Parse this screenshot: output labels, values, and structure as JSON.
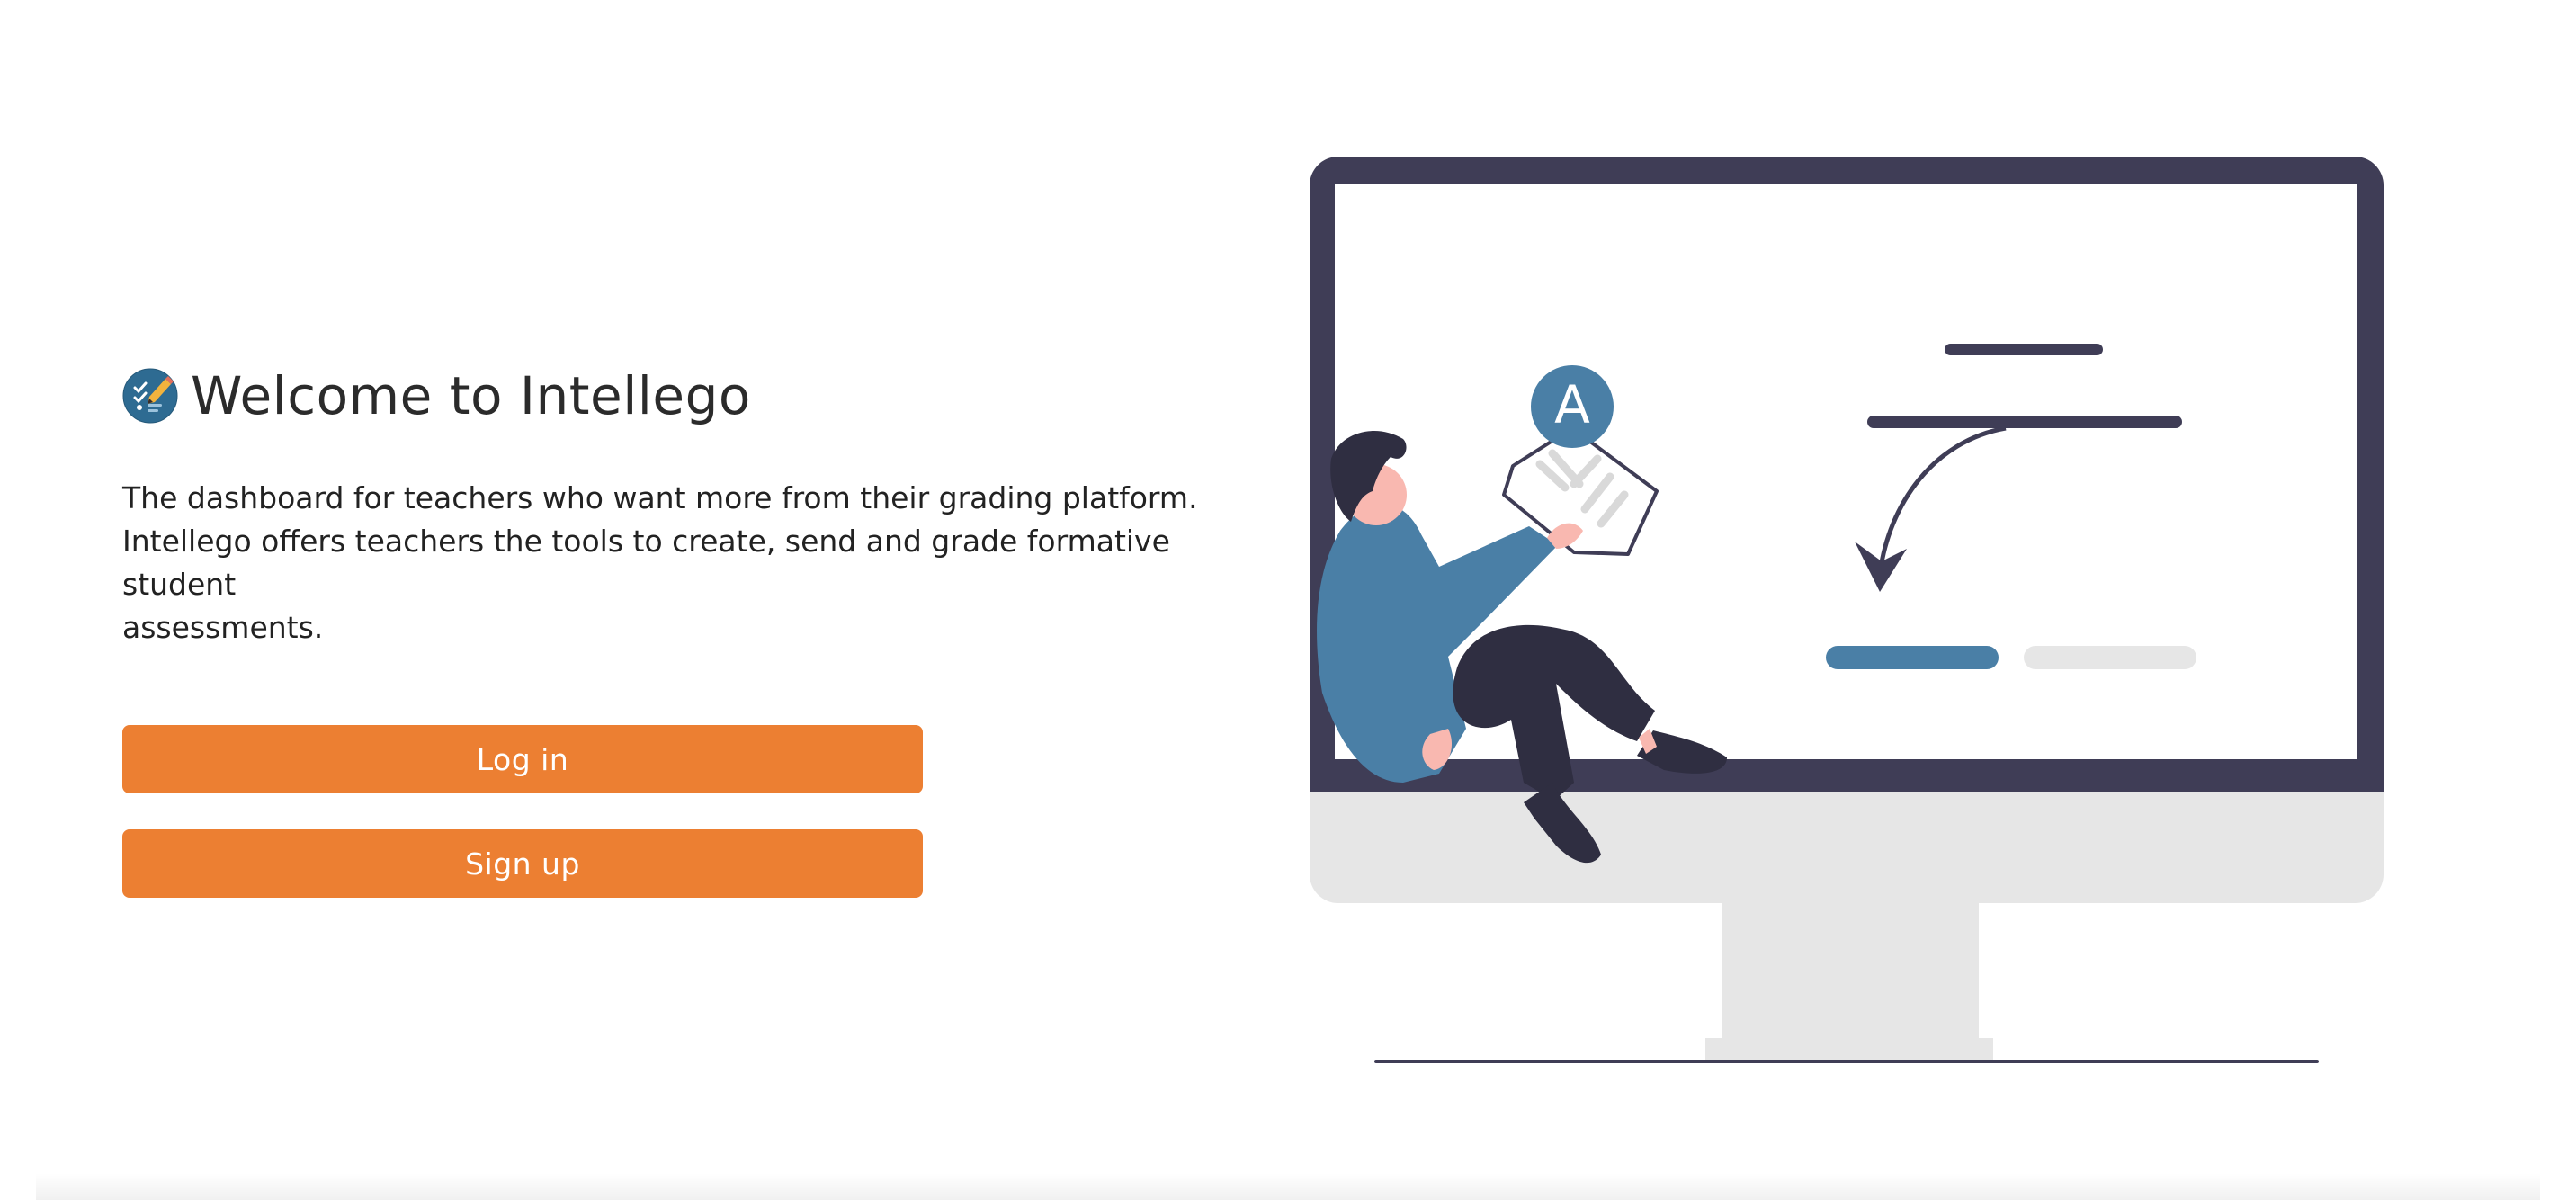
{
  "header": {
    "logo_icon": "intellego-logo-icon",
    "title": "Welcome to Intellego"
  },
  "main": {
    "description_line1": "The dashboard for teachers who want more from their grading platform.",
    "description_line2": "Intellego offers teachers the tools to create, send and grade formative student",
    "description_line3": "assessments.",
    "login_label": "Log in",
    "signup_label": "Sign up"
  },
  "illustration": {
    "paper_grade_letter": "A",
    "icon": "teacher-monitor-illustration"
  },
  "colors": {
    "accent": "#ec7f32",
    "monitor_frame": "#3f3d56",
    "illustration_blue": "#4a7fa6",
    "neutral_light": "#e6e6e6"
  }
}
